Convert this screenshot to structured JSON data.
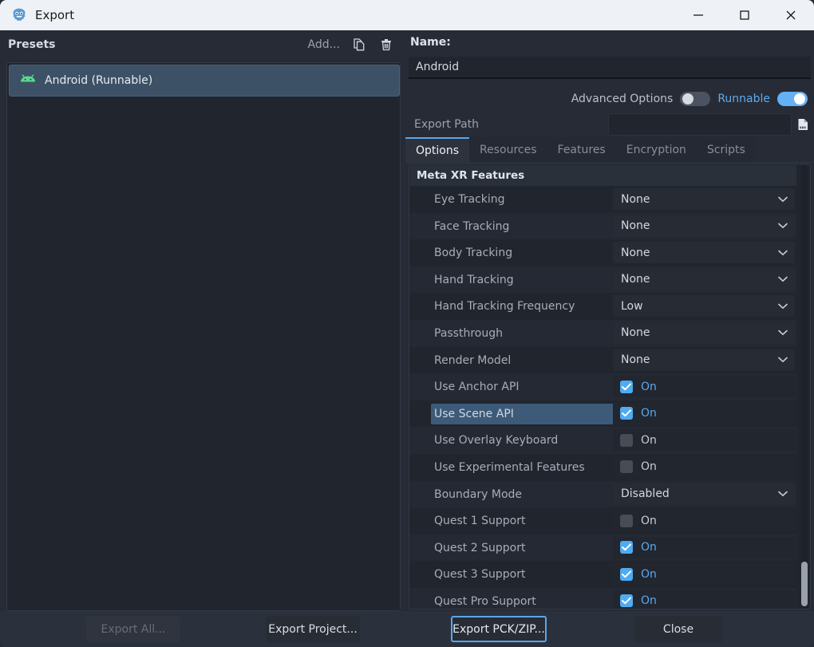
{
  "window": {
    "title": "Export",
    "icon": "godot-icon",
    "controls": {
      "minimize": "minimize-icon",
      "maximize": "maximize-icon",
      "close": "close-icon"
    }
  },
  "presets": {
    "header_label": "Presets",
    "add_label": "Add...",
    "duplicate_icon": "duplicate-icon",
    "delete_icon": "trash-icon",
    "items": [
      {
        "label": "Android (Runnable)",
        "icon": "android-icon",
        "selected": true
      }
    ]
  },
  "details": {
    "name_label": "Name:",
    "name_value": "Android",
    "advanced_options_label": "Advanced Options",
    "advanced_options_on": false,
    "runnable_label": "Runnable",
    "runnable_on": true,
    "export_path_label": "Export Path",
    "export_path_value": "",
    "export_path_placeholder": "",
    "browse_icon": "file-browse-icon"
  },
  "tabs": [
    {
      "label": "Options",
      "active": true
    },
    {
      "label": "Resources",
      "active": false
    },
    {
      "label": "Features",
      "active": false
    },
    {
      "label": "Encryption",
      "active": false
    },
    {
      "label": "Scripts",
      "active": false
    }
  ],
  "options": {
    "section_title": "Meta XR Features",
    "rows": [
      {
        "label": "Eye Tracking",
        "type": "dropdown",
        "value": "None",
        "selected": false
      },
      {
        "label": "Face Tracking",
        "type": "dropdown",
        "value": "None",
        "selected": false
      },
      {
        "label": "Body Tracking",
        "type": "dropdown",
        "value": "None",
        "selected": false
      },
      {
        "label": "Hand Tracking",
        "type": "dropdown",
        "value": "None",
        "selected": false
      },
      {
        "label": "Hand Tracking Frequency",
        "type": "dropdown",
        "value": "Low",
        "selected": false
      },
      {
        "label": "Passthrough",
        "type": "dropdown",
        "value": "None",
        "selected": false
      },
      {
        "label": "Render Model",
        "type": "dropdown",
        "value": "None",
        "selected": false
      },
      {
        "label": "Use Anchor API",
        "type": "checkbox",
        "value": "On",
        "checked": true,
        "selected": false
      },
      {
        "label": "Use Scene API",
        "type": "checkbox",
        "value": "On",
        "checked": true,
        "selected": true
      },
      {
        "label": "Use Overlay Keyboard",
        "type": "checkbox",
        "value": "On",
        "checked": false,
        "selected": false
      },
      {
        "label": "Use Experimental Features",
        "type": "checkbox",
        "value": "On",
        "checked": false,
        "selected": false
      },
      {
        "label": "Boundary Mode",
        "type": "dropdown",
        "value": "Disabled",
        "selected": false
      },
      {
        "label": "Quest 1 Support",
        "type": "checkbox",
        "value": "On",
        "checked": false,
        "selected": false
      },
      {
        "label": "Quest 2 Support",
        "type": "checkbox",
        "value": "On",
        "checked": true,
        "selected": false
      },
      {
        "label": "Quest 3 Support",
        "type": "checkbox",
        "value": "On",
        "checked": true,
        "selected": false
      },
      {
        "label": "Quest Pro Support",
        "type": "checkbox",
        "value": "On",
        "checked": true,
        "selected": false
      }
    ]
  },
  "footer": {
    "export_all": "Export All...",
    "export_all_disabled": true,
    "export_project": "Export Project...",
    "export_pck": "Export PCK/ZIP...",
    "export_pck_focused": true,
    "close": "Close"
  },
  "colors": {
    "accent": "#5aa6e8",
    "checkbox_on": "#4fabf2",
    "selection": "#3d5a78",
    "panel_bg": "#21252e",
    "window_bg": "#262b35"
  }
}
